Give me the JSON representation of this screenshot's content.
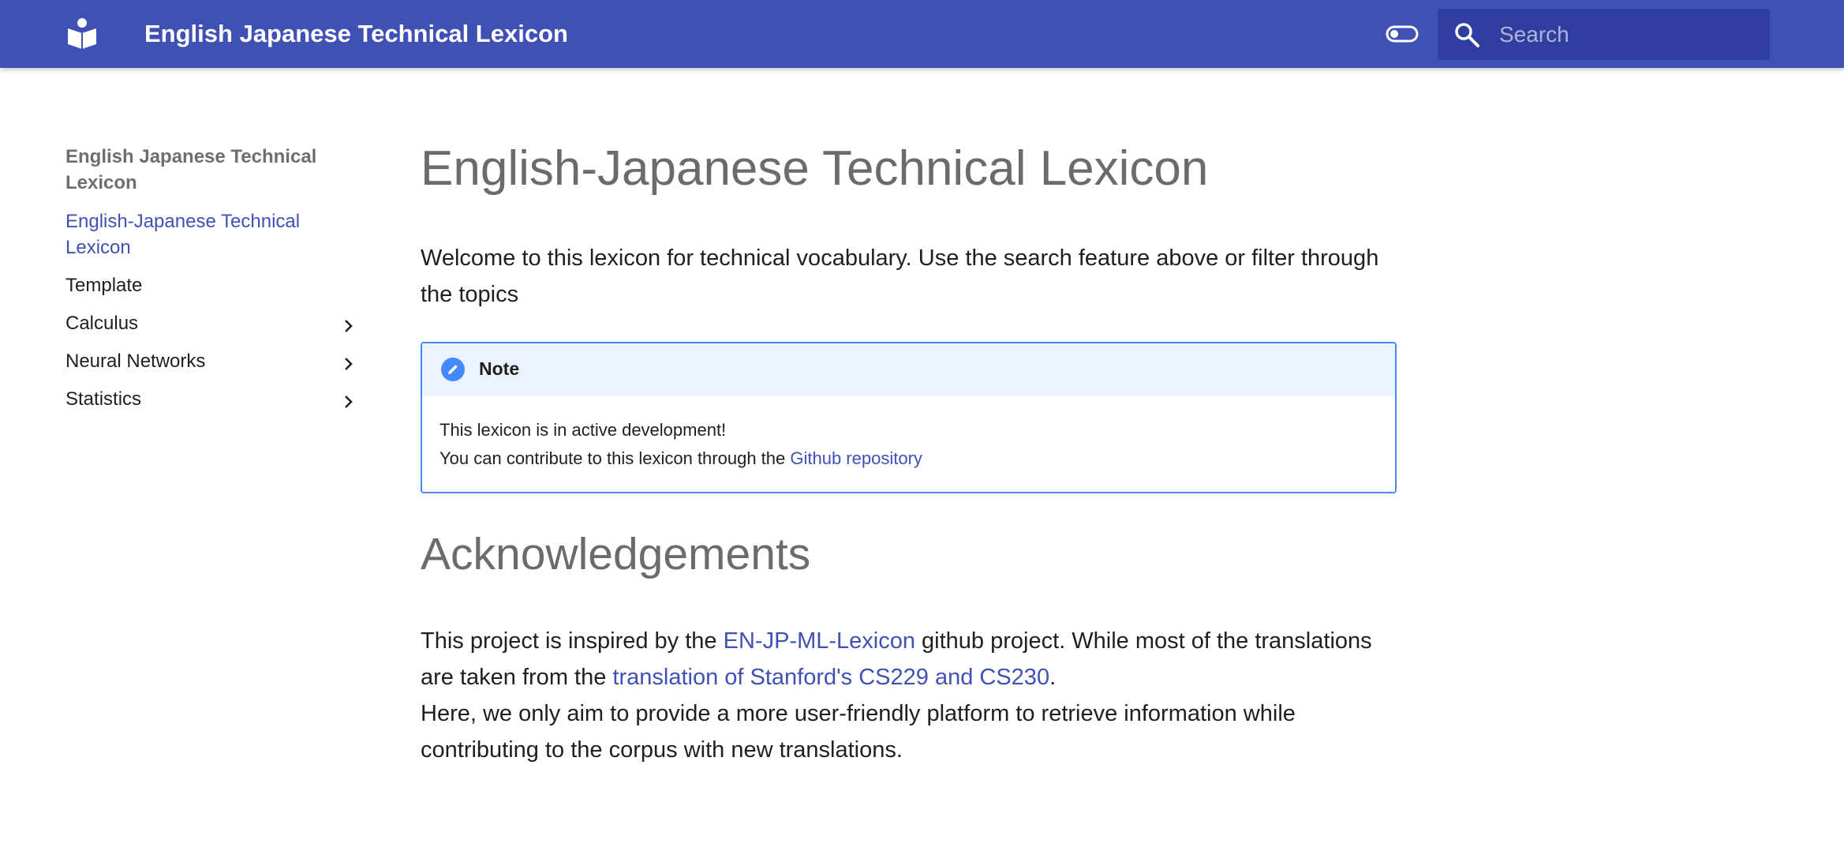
{
  "header": {
    "site_title": "English Japanese Technical Lexicon",
    "search_placeholder": "Search",
    "brand_color": "#3f51b5",
    "icons": [
      "book-reader-icon",
      "theme-toggle-icon",
      "search-icon"
    ]
  },
  "sidebar": {
    "title": "English Japanese Technical Lexicon",
    "items": [
      {
        "label": "English-Japanese Technical Lexicon",
        "active": true
      },
      {
        "label": "Template",
        "expandable": false
      },
      {
        "label": "Calculus",
        "expandable": true
      },
      {
        "label": "Neural Networks",
        "expandable": true
      },
      {
        "label": "Statistics",
        "expandable": true
      }
    ]
  },
  "content": {
    "page_title": "English-Japanese Technical Lexicon",
    "intro": "Welcome to this lexicon for technical vocabulary. Use the search feature above or filter through the topics",
    "note": {
      "title": "Note",
      "line1": "This lexicon is in active development!",
      "line2_prefix": "You can contribute to this lexicon through the ",
      "line2_link": "Github repository",
      "accent_color": "#448aff"
    },
    "ack_heading": "Acknowledgements",
    "ack": {
      "p1_a": "This project is inspired by the ",
      "p1_link1": "EN-JP-ML-Lexicon",
      "p1_b": " github project. While most of the translations are taken from the ",
      "p1_link2": "translation of Stanford's CS229 and CS230",
      "p1_c": ".",
      "p2": "Here, we only aim to provide a more user-friendly platform to retrieve information while contributing to the corpus with new translations."
    }
  }
}
